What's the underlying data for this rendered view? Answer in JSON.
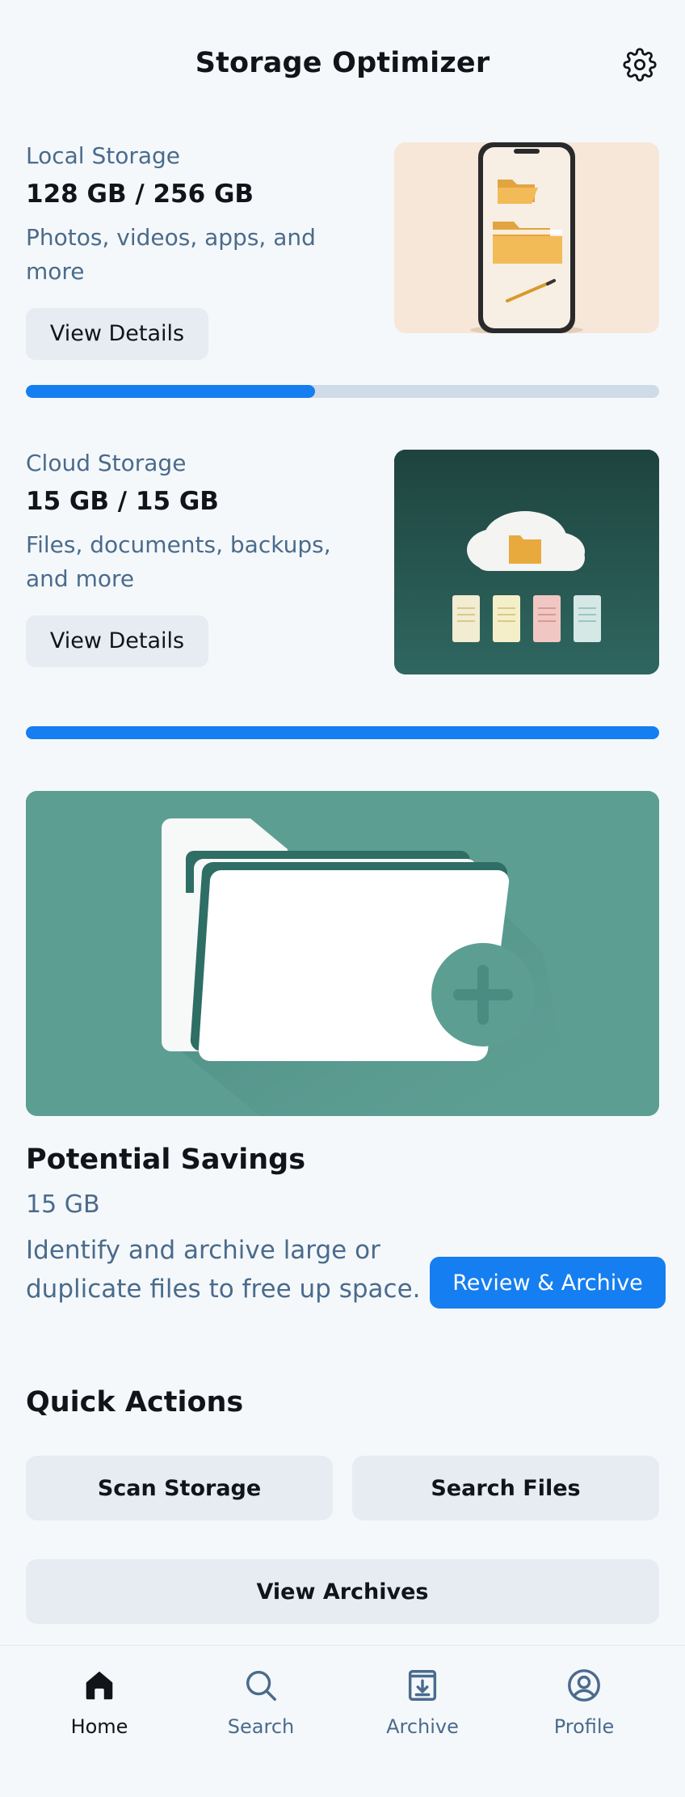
{
  "header": {
    "title": "Storage Optimizer",
    "settings_icon": "gear-icon"
  },
  "local_storage": {
    "label": "Local Storage",
    "amount": "128 GB / 256 GB",
    "description": "Photos, videos, apps, and more",
    "button_label": "View Details",
    "usage_fraction": 0.457
  },
  "cloud_storage": {
    "label": "Cloud Storage",
    "amount": "15 GB / 15 GB",
    "description": "Files, documents, backups, and more",
    "button_label": "View Details",
    "usage_fraction": 1.0
  },
  "savings": {
    "title": "Potential Savings",
    "amount": "15 GB",
    "description": "Identify and archive large or duplicate files to free up space.",
    "button_label": "Review & Archive"
  },
  "quick_actions": {
    "title": "Quick Actions",
    "scan_label": "Scan Storage",
    "search_label": "Search Files",
    "archives_label": "View Archives"
  },
  "nav": {
    "items": [
      {
        "label": "Home",
        "icon": "home-icon",
        "active": true
      },
      {
        "label": "Search",
        "icon": "search-icon",
        "active": false
      },
      {
        "label": "Archive",
        "icon": "archive-icon",
        "active": false
      },
      {
        "label": "Profile",
        "icon": "profile-icon",
        "active": false
      }
    ]
  },
  "colors": {
    "accent": "#157ef0",
    "muted_text": "#4a6b8c",
    "button_bg": "#e7ebf2",
    "progress_track": "#cfdbe7"
  }
}
